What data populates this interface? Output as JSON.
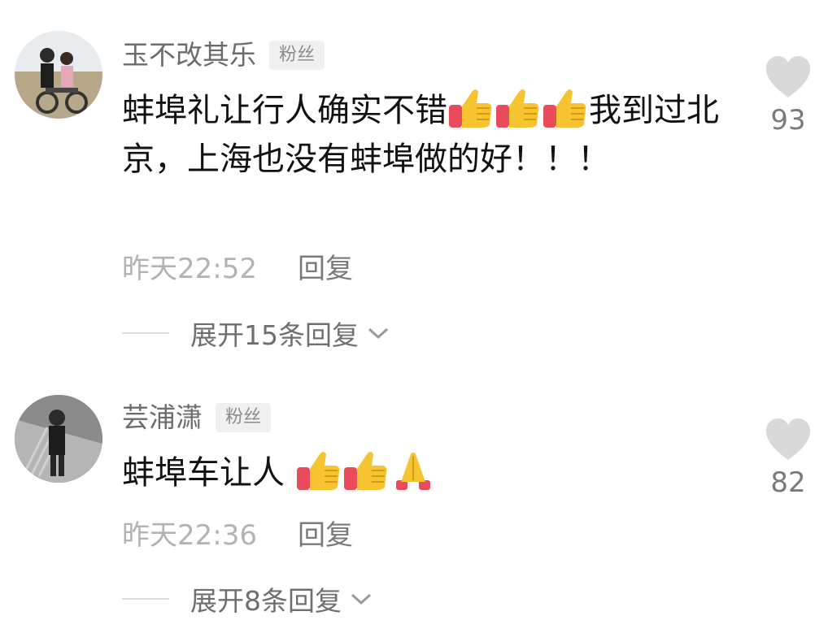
{
  "comments": [
    {
      "username": "玉不改其乐",
      "badge": "粉丝",
      "text_before_emoji": "蚌埠礼让行人确实不错",
      "emojis": [
        "thumbs-up-icon",
        "thumbs-up-icon",
        "thumbs-up-icon"
      ],
      "text_after_emoji": "我到过北京，上海也没有蚌埠做的好！！！",
      "timestamp": "昨天22:52",
      "reply_label": "回复",
      "expand_label": "展开15条回复",
      "like_count": "93"
    },
    {
      "username": "芸浦潇",
      "badge": "粉丝",
      "text_before_emoji": "蚌埠车让人",
      "emojis": [
        "thumbs-up-icon",
        "thumbs-up-icon",
        "folded-hands-icon"
      ],
      "text_after_emoji": "",
      "timestamp": "昨天22:36",
      "reply_label": "回复",
      "expand_label": "展开8条回复",
      "like_count": "82"
    }
  ],
  "colors": {
    "username": "#6c6c6c",
    "timestamp": "#b3b3b3",
    "heart": "#d9d9d9",
    "thumb_yellow": "#f7c431",
    "cuff_red": "#e94b5a"
  },
  "icons": {
    "like": "heart-icon",
    "expand": "chevron-down-icon"
  }
}
